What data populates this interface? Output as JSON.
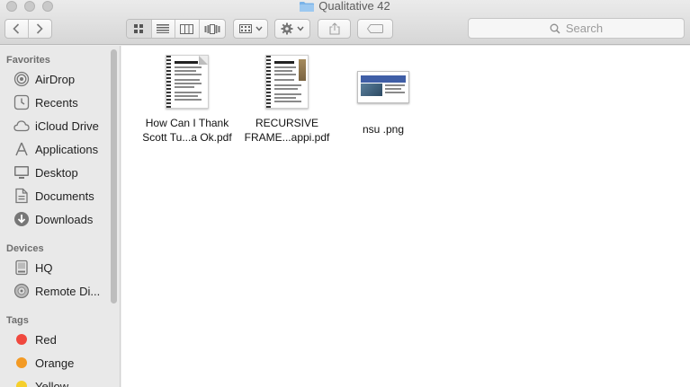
{
  "window": {
    "title": "Qualitative 42"
  },
  "toolbar": {
    "search_placeholder": "Search",
    "back_icon": "chevron-left",
    "forward_icon": "chevron-right",
    "view_modes": [
      "icon-view",
      "list-view",
      "column-view",
      "cover-flow-view"
    ],
    "active_view": "icon-view"
  },
  "sidebar": {
    "favorites_title": "Favorites",
    "favorites": [
      {
        "label": "AirDrop",
        "icon": "airdrop-icon"
      },
      {
        "label": "Recents",
        "icon": "recents-icon"
      },
      {
        "label": "iCloud Drive",
        "icon": "cloud-icon"
      },
      {
        "label": "Applications",
        "icon": "applications-icon"
      },
      {
        "label": "Desktop",
        "icon": "desktop-icon"
      },
      {
        "label": "Documents",
        "icon": "documents-icon"
      },
      {
        "label": "Downloads",
        "icon": "downloads-icon"
      }
    ],
    "devices_title": "Devices",
    "devices": [
      {
        "label": "HQ",
        "icon": "hard-drive-icon"
      },
      {
        "label": "Remote Di...",
        "icon": "remote-disc-icon"
      }
    ],
    "tags_title": "Tags",
    "tags": [
      {
        "label": "Red",
        "color": "#f0483e"
      },
      {
        "label": "Orange",
        "color": "#f39a24"
      },
      {
        "label": "Yellow",
        "color": "#f5cf2c"
      }
    ]
  },
  "files": [
    {
      "name_line1": "How Can I Thank",
      "name_line2": "Scott Tu...a Ok.pdf",
      "kind": "pdf"
    },
    {
      "name_line1": "RECURSIVE",
      "name_line2": "FRAME...appi.pdf",
      "kind": "pdf"
    },
    {
      "name_line1": "nsu .png",
      "name_line2": "",
      "kind": "png"
    }
  ]
}
